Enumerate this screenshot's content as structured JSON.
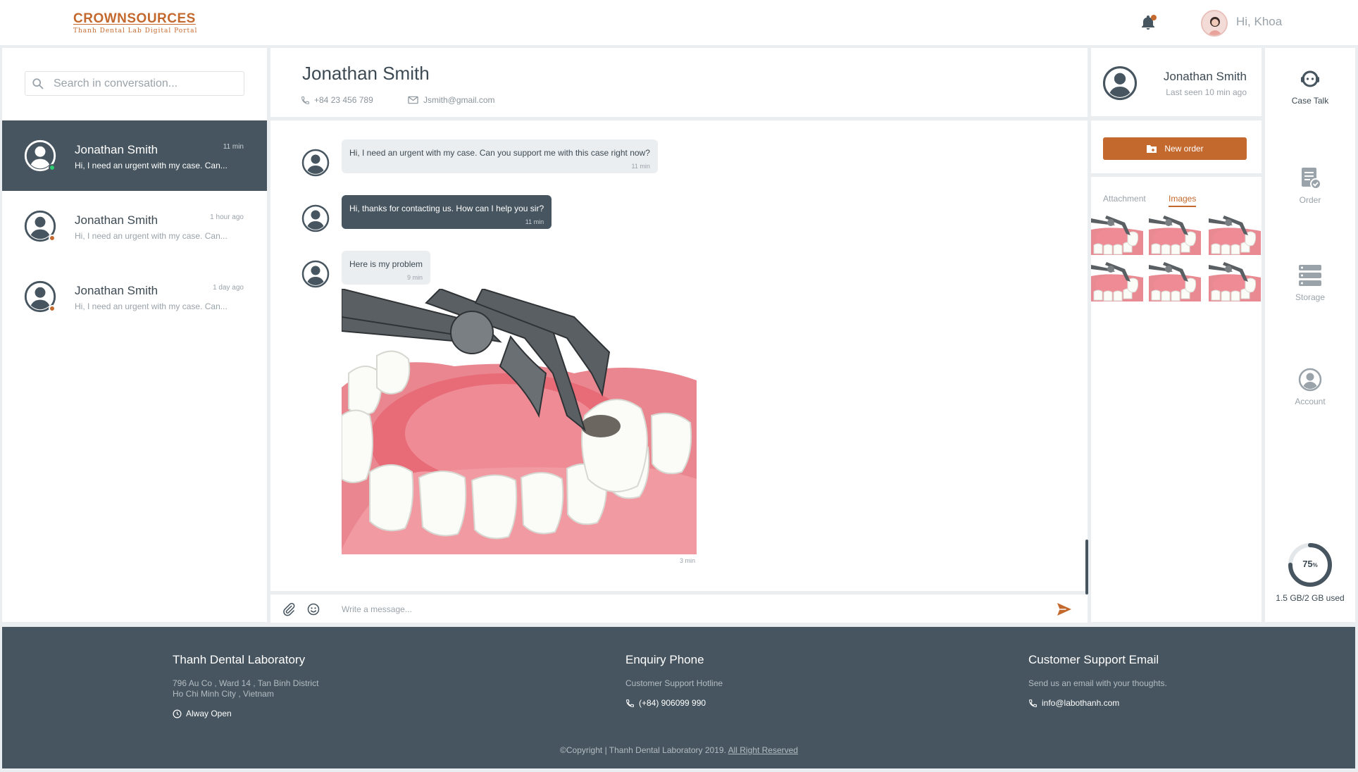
{
  "brand": {
    "name": "CROWNSOURCES",
    "tagline": "Thanh Dental Lab Digital Portal",
    "accent": "#c4692e",
    "dark": "#46555f"
  },
  "header": {
    "greeting": "Hi, Khoa",
    "icons": [
      "bell-icon",
      "user-avatar"
    ]
  },
  "search": {
    "placeholder": "Search in conversation..."
  },
  "conversations": [
    {
      "name": "Jonathan Smith",
      "time": "11 min",
      "snippet": "Hi, I need an urgent with my case. Can...",
      "status": "online",
      "status_color": "#2ecc71",
      "active": true
    },
    {
      "name": "Jonathan Smith",
      "time": "1 hour ago",
      "snippet": "Hi, I need an urgent with my case. Can...",
      "status": "away",
      "status_color": "#c4692e",
      "active": false
    },
    {
      "name": "Jonathan Smith",
      "time": "1 day ago",
      "snippet": "Hi, I need an urgent with my case. Can...",
      "status": "away",
      "status_color": "#c4692e",
      "active": false
    }
  ],
  "chat": {
    "contact_name": "Jonathan Smith",
    "phone": "+84 23 456 789",
    "email": "Jsmith@gmail.com",
    "messages": [
      {
        "text": "Hi, I need an urgent with my case. Can you support me with this case right now?",
        "time": "11 min",
        "style": "light"
      },
      {
        "text": "Hi, thanks for contacting us. How can I help you sir?",
        "time": "11 min",
        "style": "dark"
      },
      {
        "text": "Here is my problem",
        "time": "9 min",
        "style": "light"
      }
    ],
    "image_message_time": "3 min",
    "composer_placeholder": "Write a message..."
  },
  "profile": {
    "name": "Jonathan Smith",
    "last_seen": "Last seen 10 min ago",
    "new_order_label": "New order",
    "tabs": [
      {
        "label": "Attachment",
        "active": false
      },
      {
        "label": "Images",
        "active": true
      }
    ]
  },
  "nav": {
    "items": [
      {
        "label": "Case Talk",
        "icon": "support-agent-icon",
        "active": true
      },
      {
        "label": "Order",
        "icon": "order-form-icon",
        "active": false
      },
      {
        "label": "Storage",
        "icon": "storage-stack-icon",
        "active": false
      },
      {
        "label": "Account",
        "icon": "account-circle-icon",
        "active": false
      }
    ],
    "storage": {
      "percent": 75,
      "percent_label": "75",
      "percent_unit": "%",
      "usage": "1.5 GB/2 GB used"
    }
  },
  "footer": {
    "lab": {
      "title": "Thanh Dental Laboratory",
      "address_line1": "796 Au Co , Ward 14 , Tan Binh District",
      "address_line2": "Ho Chi Minh City , Vietnam",
      "hours": "Alway Open"
    },
    "phone": {
      "title": "Enquiry Phone",
      "subtitle": "Customer Support Hotline",
      "number": "(+84) 906099 990"
    },
    "email": {
      "title": "Customer Support Email",
      "subtitle": "Send us an email with your thoughts.",
      "address": "info@labothanh.com"
    },
    "copyright_prefix": "©Copyright | Thanh Dental Laboratory 2019.",
    "copyright_link": "All Right Reserved"
  }
}
